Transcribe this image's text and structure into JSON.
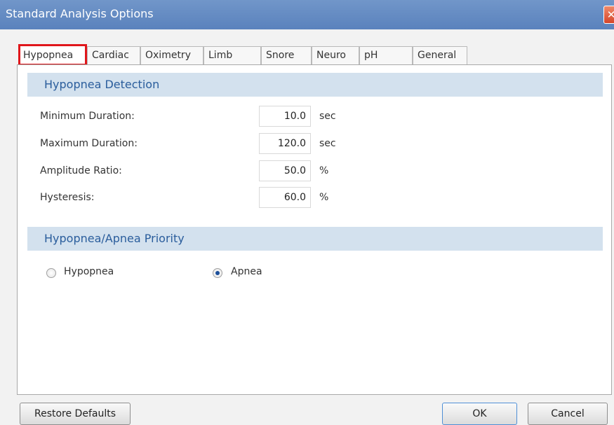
{
  "window": {
    "title": "Standard Analysis Options",
    "close_glyph": "✕"
  },
  "tabs": [
    {
      "label": "Hypopnea",
      "active": true
    },
    {
      "label": "Cardiac",
      "active": false
    },
    {
      "label": "Oximetry",
      "active": false
    },
    {
      "label": "Limb",
      "active": false
    },
    {
      "label": "Snore",
      "active": false
    },
    {
      "label": "Neuro",
      "active": false
    },
    {
      "label": "pH",
      "active": false
    },
    {
      "label": "General",
      "active": false
    }
  ],
  "detection": {
    "header": "Hypopnea Detection",
    "fields": [
      {
        "label": "Minimum Duration:",
        "value": "10.0",
        "unit": "sec"
      },
      {
        "label": "Maximum Duration:",
        "value": "120.0",
        "unit": "sec"
      },
      {
        "label": "Amplitude Ratio:",
        "value": "50.0",
        "unit": "%"
      },
      {
        "label": "Hysteresis:",
        "value": "60.0",
        "unit": "%"
      }
    ]
  },
  "priority": {
    "header": "Hypopnea/Apnea Priority",
    "options": [
      {
        "label": "Hypopnea",
        "selected": false
      },
      {
        "label": "Apnea",
        "selected": true
      }
    ]
  },
  "buttons": {
    "restore": "Restore Defaults",
    "ok": "OK",
    "cancel": "Cancel"
  },
  "colors": {
    "titlebar": "#5a82bd",
    "section_header_bg": "#d3e1ee",
    "section_header_text": "#2a5d9c",
    "active_tab_highlight": "#e0161b"
  }
}
